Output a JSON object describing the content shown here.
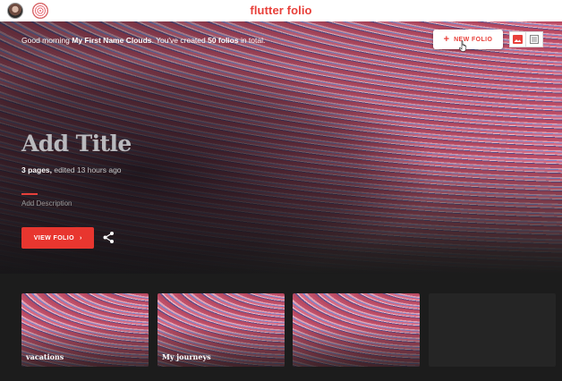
{
  "app": {
    "logo_text": "flutter folio",
    "accent": "#e8403a"
  },
  "header": {
    "avatars": [
      {
        "name": "user-avatar"
      },
      {
        "name": "fingerprint-avatar"
      }
    ]
  },
  "hero": {
    "greeting_prefix": "Good morning ",
    "user_name": "My First Name Clouds",
    "greeting_mid": ". You've created ",
    "folio_count": "50 folios",
    "greeting_suffix": " in total.",
    "new_folio_icon": "+",
    "new_folio_label": "NEW FOLIO",
    "title": "Add Title",
    "pages": "3 pages,",
    "edited": " edited 13 hours ago",
    "description_placeholder": "Add Description",
    "view_folio_label": "VIEW FOLIO",
    "view_folio_chevron": "›",
    "icons": {
      "view_toggle": [
        "grid-view-icon",
        "list-view-icon"
      ],
      "share": "share-icon",
      "cursor": "hand-pointer-icon"
    }
  },
  "folios": [
    {
      "label": "vacations"
    },
    {
      "label": "My journeys"
    },
    {
      "label": ""
    },
    {
      "label": ""
    }
  ]
}
